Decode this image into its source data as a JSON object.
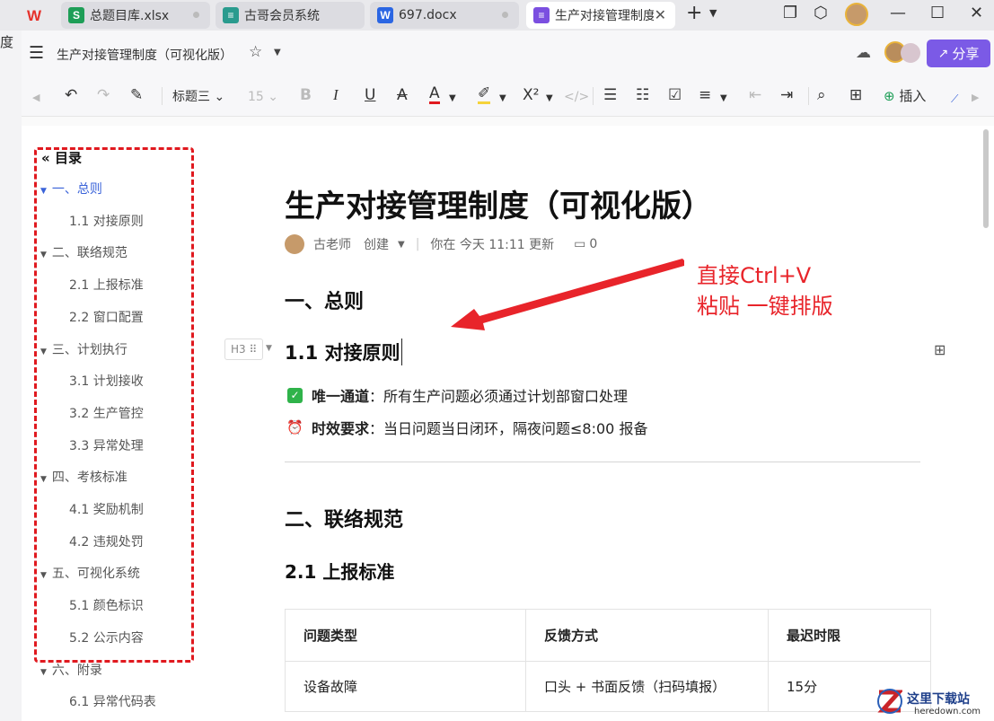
{
  "tabs": [
    {
      "label": "总题目库.xlsx",
      "icon": "S",
      "color": "#1e9e57"
    },
    {
      "label": "古哥会员系统",
      "icon": "grid",
      "color": "#2a9b8e"
    },
    {
      "label": "697.docx",
      "icon": "W",
      "color": "#2b66e3"
    },
    {
      "label": "生产对接管理制度",
      "icon": "doc",
      "color": "#7b4fe0"
    }
  ],
  "doc_header": {
    "title": "生产对接管理制度（可视化版）",
    "share_label": "分享"
  },
  "toolbar": {
    "style": "标题三",
    "font_size": "15",
    "insert_label": "插入"
  },
  "outline": {
    "title": "目录",
    "items": [
      {
        "label": "一、总则",
        "level": 1,
        "active": true
      },
      {
        "label": "1.1 对接原则",
        "level": 2
      },
      {
        "label": "二、联络规范",
        "level": 1
      },
      {
        "label": "2.1 上报标准",
        "level": 2
      },
      {
        "label": "2.2 窗口配置",
        "level": 2
      },
      {
        "label": "三、计划执行",
        "level": 1
      },
      {
        "label": "3.1 计划接收",
        "level": 2
      },
      {
        "label": "3.2 生产管控",
        "level": 2
      },
      {
        "label": "3.3 异常处理",
        "level": 2
      },
      {
        "label": "四、考核标准",
        "level": 1
      },
      {
        "label": "4.1 奖励机制",
        "level": 2
      },
      {
        "label": "4.2 违规处罚",
        "level": 2
      },
      {
        "label": "五、可视化系统",
        "level": 1
      },
      {
        "label": "5.1 颜色标识",
        "level": 2
      },
      {
        "label": "5.2 公示内容",
        "level": 2
      },
      {
        "label": "六、附录",
        "level": 1
      },
      {
        "label": "6.1 异常代码表",
        "level": 2
      }
    ]
  },
  "document": {
    "title": "生产对接管理制度（可视化版）",
    "author": "古老师",
    "created": "创建",
    "updated": "你在 今天 11:11 更新",
    "comments": "0",
    "h1_a": "一、总则",
    "h3_label": "H3",
    "h2_a": "1.1 对接原则",
    "bullet1_bold": "唯一通道",
    "bullet1_text": "：所有生产问题必须通过计划部窗口处理",
    "bullet2_bold": "时效要求",
    "bullet2_text": "：当日问题当日闭环，隔夜问题≤8:00 报备",
    "h1_b": "二、联络规范",
    "h2_b": "2.1 上报标准",
    "table": {
      "headers": [
        "问题类型",
        "反馈方式",
        "最迟时限"
      ],
      "rows": [
        [
          "设备故障",
          "口头 + 书面反馈（扫码填报）",
          "15分"
        ]
      ]
    }
  },
  "annotation": {
    "line1": "直接Ctrl+V",
    "line2": "粘贴 一键排版"
  },
  "watermark": {
    "name": "这里下载站",
    "url": "heredown.com"
  },
  "edge_text": "度"
}
